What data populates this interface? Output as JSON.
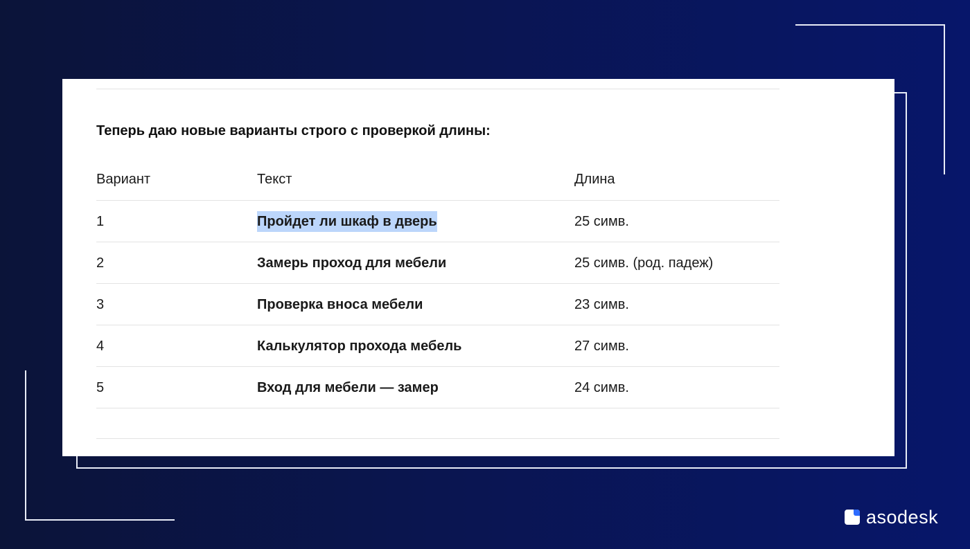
{
  "heading": "Теперь даю новые варианты строго с проверкой длины:",
  "table": {
    "headers": [
      "Вариант",
      "Текст",
      "Длина"
    ],
    "rows": [
      {
        "num": "1",
        "text": "Пройдет ли шкаф в дверь",
        "length": "25 симв.",
        "highlighted": true
      },
      {
        "num": "2",
        "text": "Замерь проход для мебели",
        "length": "25 симв. (род. падеж)",
        "highlighted": false
      },
      {
        "num": "3",
        "text": "Проверка вноса мебели",
        "length": "23 симв.",
        "highlighted": false
      },
      {
        "num": "4",
        "text": "Калькулятор прохода мебель",
        "length": "27 симв.",
        "highlighted": false
      },
      {
        "num": "5",
        "text": "Вход для мебели — замер",
        "length": "24 симв.",
        "highlighted": false
      }
    ]
  },
  "brand": {
    "name": "asodesk",
    "icon": "asodesk-logo-icon",
    "accent": "#2d6bff"
  },
  "colors": {
    "background_start": "#0b1439",
    "background_end": "#07166a",
    "highlight": "#bcd6fb"
  }
}
